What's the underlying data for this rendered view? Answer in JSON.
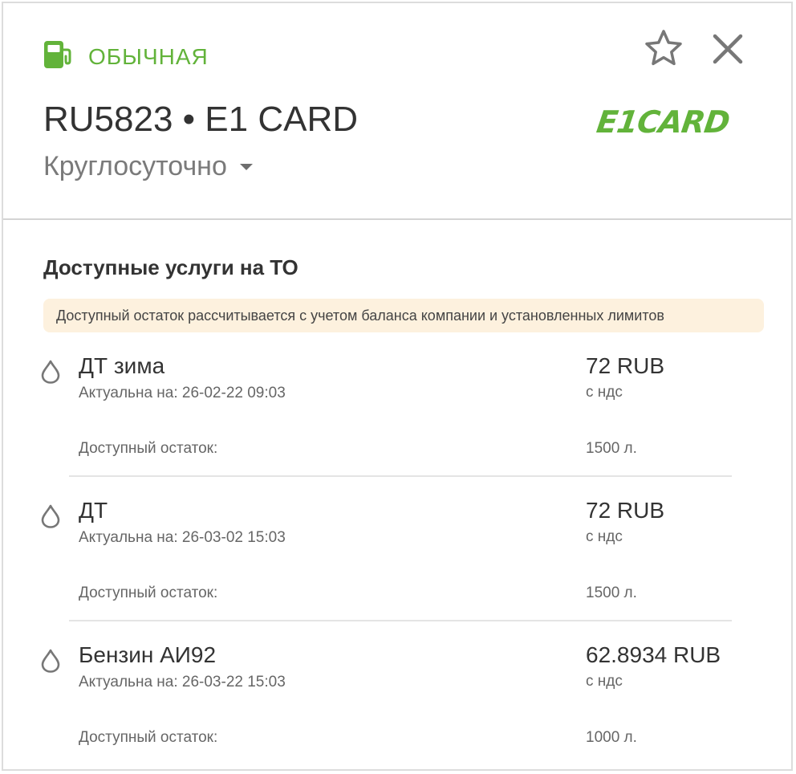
{
  "header": {
    "type_label": "ОБЫЧНАЯ",
    "station_title": "RU5823 • E1 CARD",
    "brand_logo_text": "E1CARD",
    "hours": "Круглосуточно"
  },
  "section": {
    "title": "Доступные услуги на ТО",
    "notice": "Доступный остаток рассчитывается с учетом баланса компании и установленных лимитов"
  },
  "services": [
    {
      "name": "ДТ зима",
      "date": "Актуальна на: 26-02-22 09:03",
      "price": "72 RUB",
      "vat": "с ндс",
      "rest_label": "Доступный остаток:",
      "rest_value": "1500 л."
    },
    {
      "name": "ДТ",
      "date": "Актуальна на: 26-03-02 15:03",
      "price": "72 RUB",
      "vat": "с ндс",
      "rest_label": "Доступный остаток:",
      "rest_value": "1500 л."
    },
    {
      "name": "Бензин АИ92",
      "date": "Актуальна на: 26-03-22 15:03",
      "price": "62.8934 RUB",
      "vat": "с ндс",
      "rest_label": "Доступный остаток:",
      "rest_value": "1000 л."
    }
  ],
  "icons": {
    "fuel": "fuel-pump-icon",
    "star": "star-icon",
    "close": "close-icon",
    "caret": "caret-down-icon",
    "drop": "drop-icon"
  },
  "colors": {
    "accent": "#62b33a",
    "notice_bg": "#fdf1de",
    "text": "#333333",
    "muted": "#666666"
  }
}
